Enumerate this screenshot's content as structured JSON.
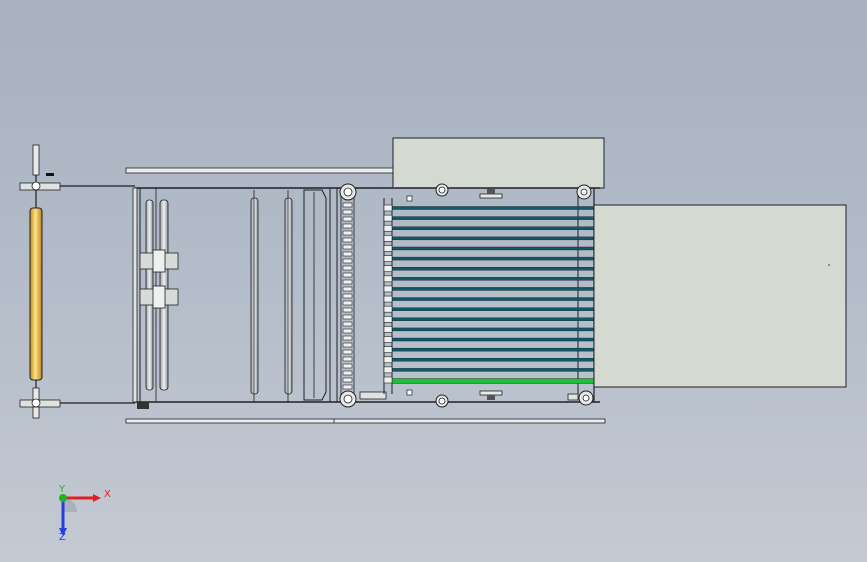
{
  "viewport": {
    "background_top": "#a7b1bf",
    "background_bottom": "#c4cad3"
  },
  "model": {
    "line_color": "#1e2126",
    "panel_fill": "#d4d9d1",
    "dark_roller_color": "#0e5a68",
    "highlight_roller_color": "#1fbf3a",
    "heated_roller_color": "#f2c84a"
  },
  "triad": {
    "x_label": "X",
    "y_label": "Y",
    "z_label": "Z",
    "x_color": "#e02020",
    "y_color": "#20b020",
    "z_color": "#2040e0"
  }
}
